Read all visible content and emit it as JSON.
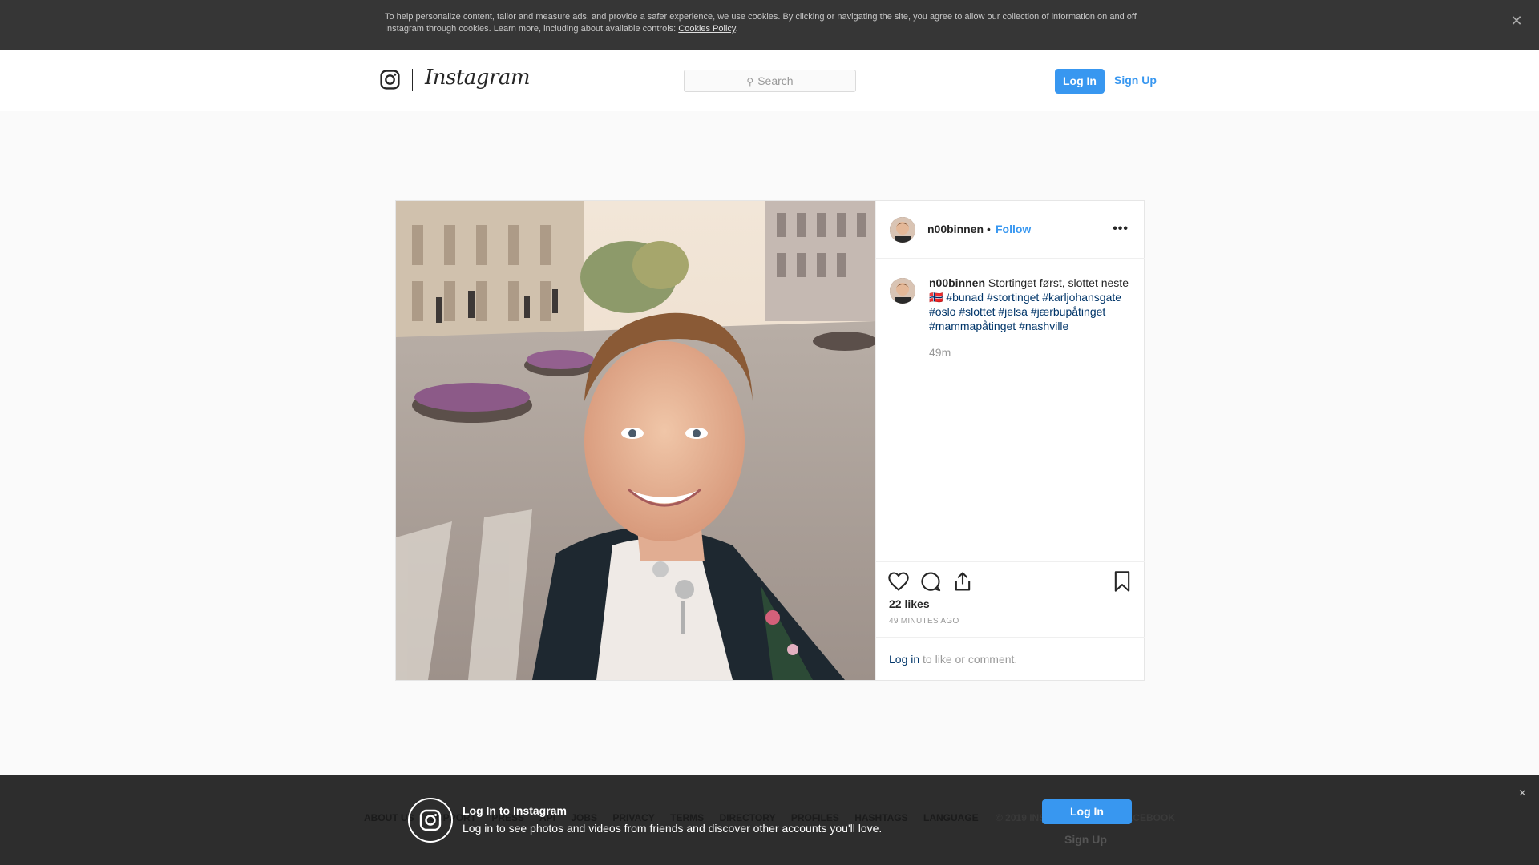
{
  "cookie_banner": {
    "text": "To help personalize content, tailor and measure ads, and provide a safer experience, we use cookies. By clicking or navigating the site, you agree to allow our collection of information on and off Instagram through cookies. Learn more, including about available controls: ",
    "link": "Cookies Policy",
    "close_icon": "close-icon"
  },
  "header": {
    "brand": "Instagram",
    "search_placeholder": "Search",
    "login_label": "Log In",
    "signup_label": "Sign Up"
  },
  "post": {
    "username": "n00binnen",
    "dot": "•",
    "follow_label": "Follow",
    "more_label": "•••",
    "caption": {
      "username": "n00binnen",
      "text": " Stortinget først, slottet neste 🇳🇴 ",
      "hashtags": [
        "#bunad",
        "#stortinget",
        "#karljohansgate",
        "#oslo",
        "#slottet",
        "#jelsa",
        "#jærbupåtinget",
        "#mammapåtinget",
        "#nashville"
      ],
      "time": "49m"
    },
    "likes": "22 likes",
    "time_ago": "49 MINUTES AGO",
    "login_prompt_link": "Log in",
    "login_prompt_text": " to like or comment."
  },
  "footer": {
    "links": [
      "ABOUT US",
      "SUPPORT",
      "PRESS",
      "API",
      "JOBS",
      "PRIVACY",
      "TERMS",
      "DIRECTORY",
      "PROFILES",
      "HASHTAGS",
      "LANGUAGE"
    ],
    "copyright": "© 2019 INSTAGRAM FROM FACEBOOK"
  },
  "login_overlay": {
    "title": "Log In to Instagram",
    "subtitle": "Log in to see photos and videos from friends and discover other accounts you'll love.",
    "login_label": "Log In",
    "signup_label": "Sign Up",
    "close_label": "×"
  }
}
